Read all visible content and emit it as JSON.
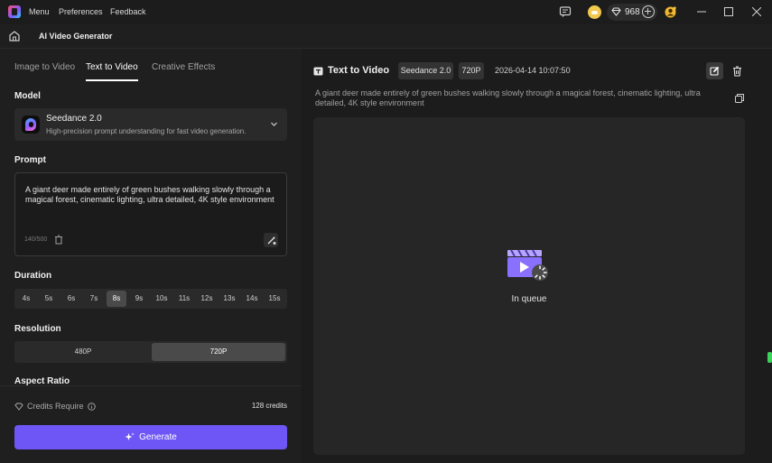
{
  "titlebar": {
    "menu_items": [
      "Menu",
      "Preferences",
      "Feedback"
    ],
    "credits": "968"
  },
  "header": {
    "title": "AI Video Generator"
  },
  "left_panel": {
    "tabs": [
      "Image to Video",
      "Text to Video",
      "Creative Effects"
    ],
    "active_tab": "Text to Video",
    "model_label": "Model",
    "model": {
      "name": "Seedance 2.0",
      "description": "High-precision prompt understanding for fast video generation."
    },
    "prompt_label": "Prompt",
    "prompt": {
      "text": "A giant deer made entirely of green bushes walking slowly through a magical forest, cinematic lighting, ultra detailed, 4K style environment",
      "count": "140/500"
    },
    "duration_label": "Duration",
    "durations": [
      "4s",
      "5s",
      "6s",
      "7s",
      "8s",
      "9s",
      "10s",
      "11s",
      "12s",
      "13s",
      "14s",
      "15s"
    ],
    "selected_duration": "8s",
    "resolution_label": "Resolution",
    "resolutions": [
      "480P",
      "720P"
    ],
    "selected_resolution": "720P",
    "aspect_label": "Aspect Ratio",
    "credits_require_label": "Credits Require",
    "credits_require_value": "128 credits",
    "generate_label": "Generate"
  },
  "right_panel": {
    "title": "Text to Video",
    "model_chip": "Seedance 2.0",
    "resolution_chip": "720P",
    "timestamp": "2026-04-14 10:07:50",
    "prompt": "A giant deer made entirely of green bushes walking slowly through a magical forest, cinematic lighting, ultra detailed, 4K style environment",
    "status": "In queue"
  },
  "colors": {
    "accent": "#6e56f6",
    "background": "#1a1a1a",
    "panel": "#1f1f1f",
    "coin": "#f2c94c"
  }
}
